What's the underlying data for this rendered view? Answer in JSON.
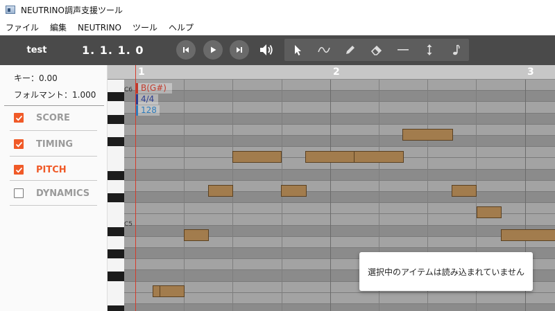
{
  "window": {
    "title": "NEUTRINO調声支援ツール"
  },
  "menu": [
    "ファイル",
    "編集",
    "NEUTRINO",
    "ツール",
    "ヘルプ"
  ],
  "toolbar": {
    "song_title": "test",
    "position": "1. 1. 1. 0",
    "transport": [
      "skip-back-icon",
      "play-icon",
      "skip-forward-icon"
    ],
    "volume_icon": "volume-icon",
    "tools": [
      "select-icon",
      "curve-icon",
      "pencil-icon",
      "eraser-icon",
      "line-icon",
      "vertical-arrows-icon",
      "note-icon"
    ]
  },
  "left_panel": {
    "key": "キー：0.00",
    "formant": "フォルマント：1.000",
    "tracks": [
      {
        "label": "SCORE",
        "checked": true,
        "active": false
      },
      {
        "label": "TIMING",
        "checked": true,
        "active": false
      },
      {
        "label": "PITCH",
        "checked": true,
        "active": true
      },
      {
        "label": "DYNAMICS",
        "checked": false,
        "active": false
      }
    ]
  },
  "roll": {
    "bars": [
      "1",
      "2",
      "3"
    ],
    "octave_labels": [
      "C6",
      "C5"
    ],
    "markers": {
      "key": "B(G#)",
      "time_signature": "4/4",
      "tempo": "128"
    }
  },
  "toast": {
    "message": "選択中のアイテムは読み込まれていません"
  },
  "colors": {
    "accent": "#f05a28",
    "note_fill": "#a27c4d",
    "playhead": "#d63a2a",
    "toolbar_bg": "#4a4a4a"
  }
}
